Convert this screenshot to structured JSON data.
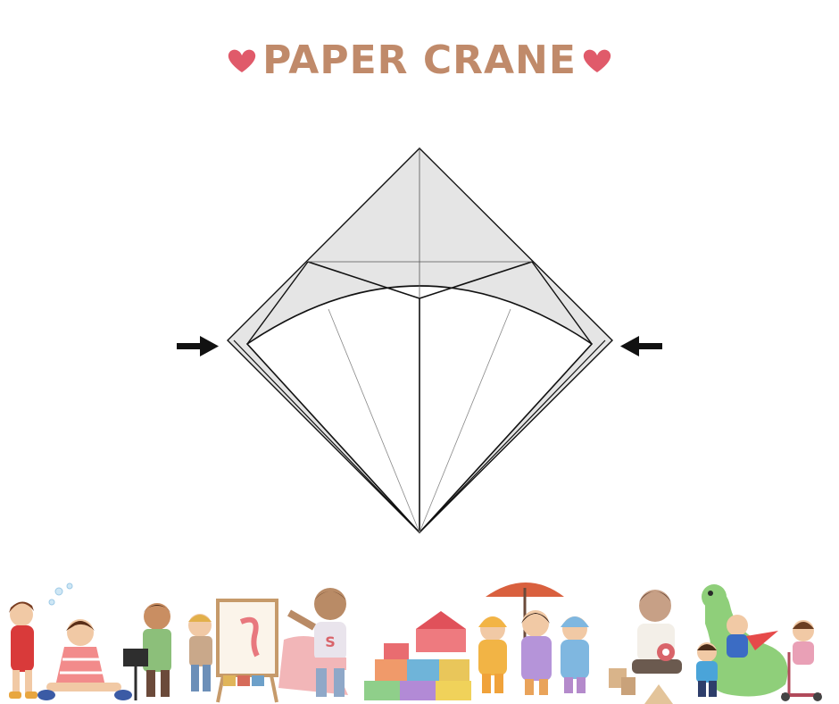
{
  "header": {
    "title": "PAPER CRANE"
  },
  "colors": {
    "title": "#c08a6a",
    "heart": "#e05a6a",
    "paper_shade": "#e5e5e5",
    "line": "#111111"
  },
  "icons": {
    "left_heart": "heart-icon",
    "right_heart": "heart-icon",
    "left_arrow": "arrow-right-icon",
    "right_arrow": "arrow-left-icon"
  }
}
